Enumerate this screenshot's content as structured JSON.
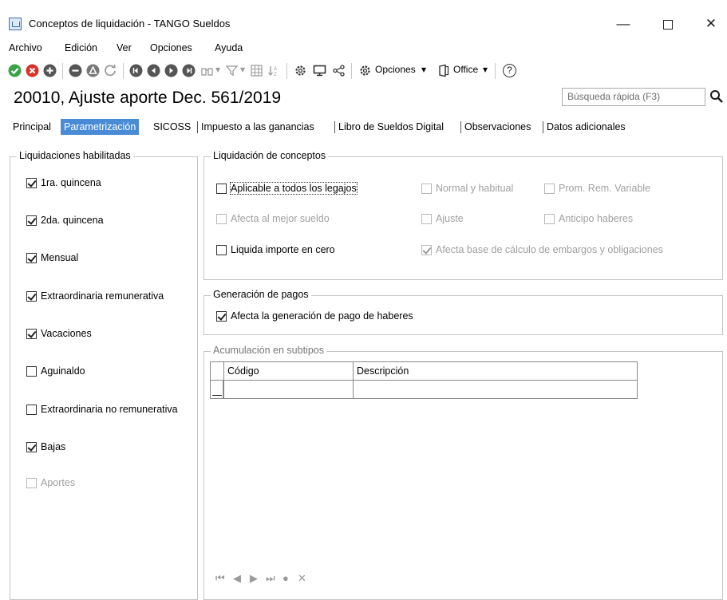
{
  "window": {
    "title": "Conceptos de liquidación - TANGO Sueldos",
    "minimize_glyph": "—",
    "close_glyph": "✕"
  },
  "menu": [
    "Archivo",
    "Edición",
    "Ver",
    "Opciones",
    "Ayuda"
  ],
  "toolbar": {
    "opciones_label": "Opciones",
    "office_label": "Office",
    "dropdown_glyph": "▾",
    "help_glyph": "?"
  },
  "record_title": "20010, Ajuste aporte Dec. 561/2019",
  "search": {
    "placeholder": "Búsqueda rápida (F3)"
  },
  "tabs": [
    "Principal",
    "Parametrización",
    "SICOSS",
    "Impuesto a las ganancias",
    "Libro de Sueldos Digital",
    "Observaciones",
    "Datos adicionales"
  ],
  "liquidaciones": {
    "legend": "Liquidaciones habilitadas",
    "items": [
      {
        "label": "1ra. quincena",
        "checked": true,
        "enabled": true
      },
      {
        "label": "2da. quincena",
        "checked": true,
        "enabled": true
      },
      {
        "label": "Mensual",
        "checked": true,
        "enabled": true
      },
      {
        "label": "Extraordinaria remunerativa",
        "checked": true,
        "enabled": true
      },
      {
        "label": "Vacaciones",
        "checked": true,
        "enabled": true
      },
      {
        "label": "Aguinaldo",
        "checked": false,
        "enabled": true
      },
      {
        "label": "Extraordinaria no remunerativa",
        "checked": false,
        "enabled": true
      },
      {
        "label": "Bajas",
        "checked": true,
        "enabled": true
      },
      {
        "label": "Aportes",
        "checked": false,
        "enabled": false
      }
    ]
  },
  "liquidacion_conceptos": {
    "legend": "Liquidación de conceptos",
    "aplicable": "Aplicable a todos los legajos",
    "normal": "Normal y habitual",
    "prom": "Prom. Rem. Variable",
    "afecta_mejor": "Afecta al mejor sueldo",
    "ajuste": "Ajuste",
    "anticipo": "Anticipo haberes",
    "liquida_cero": "Liquida importe en cero",
    "afecta_base": "Afecta base de cálculo de embargos y obligaciones"
  },
  "generacion_pagos": {
    "legend": "Generación de pagos",
    "afecta": "Afecta la generación de pago de haberes"
  },
  "acumulacion": {
    "legend": "Acumulación en subtipos",
    "columns": [
      "Código",
      "Descripción"
    ],
    "nav": [
      "⏮",
      "◀",
      "▶",
      "⏭",
      "●",
      "✕"
    ]
  }
}
